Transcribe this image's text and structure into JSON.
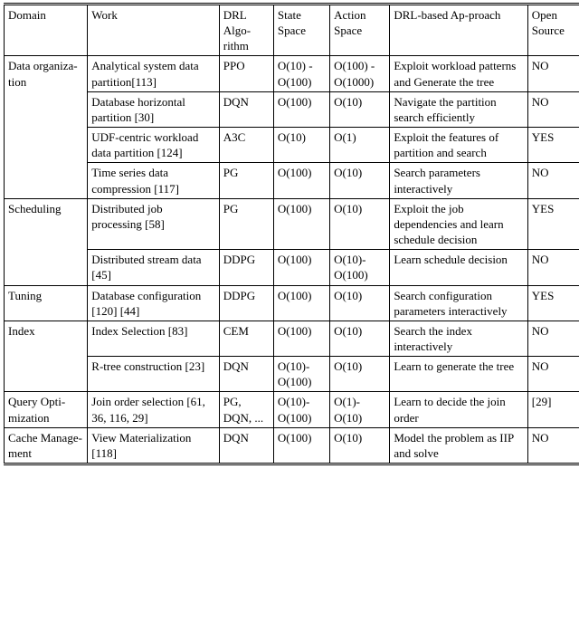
{
  "table": {
    "columns": [
      {
        "key": "domain",
        "label": "Domain"
      },
      {
        "key": "work",
        "label": "Work"
      },
      {
        "key": "algorithm",
        "label": "DRL Algo-rithm"
      },
      {
        "key": "state",
        "label": "State Space"
      },
      {
        "key": "action",
        "label": "Action Space"
      },
      {
        "key": "approach",
        "label": "DRL-based Ap-proach"
      },
      {
        "key": "open",
        "label": "Open Source"
      }
    ],
    "groups": [
      {
        "domain": "Data organiza-tion",
        "rows": [
          {
            "work": "Analytical system data partition[113]",
            "algorithm": "PPO",
            "state": "O(10) - O(100)",
            "action": "O(100) - O(1000)",
            "approach": "Exploit workload patterns and Generate the tree",
            "open": "NO"
          },
          {
            "work": "Database horizontal partition [30]",
            "algorithm": "DQN",
            "state": "O(100)",
            "action": "O(10)",
            "approach": "Navigate the partition search efficiently",
            "open": "NO"
          },
          {
            "work": "UDF-centric workload data partition [124]",
            "algorithm": "A3C",
            "state": "O(10)",
            "action": "O(1)",
            "approach": "Exploit the features of partition and search",
            "open": "YES"
          },
          {
            "work": "Time series data compression [117]",
            "algorithm": "PG",
            "state": "O(100)",
            "action": "O(10)",
            "approach": "Search parameters interactively",
            "open": "NO"
          }
        ]
      },
      {
        "domain": "Scheduling",
        "rows": [
          {
            "work": "Distributed job processing [58]",
            "algorithm": "PG",
            "state": "O(100)",
            "action": "O(10)",
            "approach": "Exploit the job dependencies and learn schedule decision",
            "open": "YES"
          },
          {
            "work": "Distributed stream data [45]",
            "algorithm": "DDPG",
            "state": "O(100)",
            "action": "O(10)-O(100)",
            "approach": "Learn schedule decision",
            "open": "NO"
          }
        ]
      },
      {
        "domain": "Tuning",
        "rows": [
          {
            "work": "Database configuration [120] [44]",
            "algorithm": "DDPG",
            "state": "O(100)",
            "action": "O(10)",
            "approach": "Search configuration parameters interactively",
            "open": "YES"
          }
        ]
      },
      {
        "domain": "Index",
        "rows": [
          {
            "work": "Index Selection [83]",
            "algorithm": "CEM",
            "state": "O(100)",
            "action": "O(10)",
            "approach": "Search the index interactively",
            "open": "NO"
          },
          {
            "work": "R-tree construction [23]",
            "algorithm": "DQN",
            "state": "O(10)-O(100)",
            "action": "O(10)",
            "approach": "Learn to generate the tree",
            "open": "NO"
          }
        ]
      },
      {
        "domain": "Query Opti-mization",
        "rows": [
          {
            "work": "Join order selection [61, 36, 116, 29]",
            "algorithm": "PG, DQN, ...",
            "state": "O(10)-O(100)",
            "action": "O(1)-O(10)",
            "approach": "Learn to decide the join order",
            "open": "[29]"
          }
        ]
      },
      {
        "domain": "Cache Manage-ment",
        "rows": [
          {
            "work": "View Materialization [118]",
            "algorithm": "DQN",
            "state": "O(100)",
            "action": "O(10)",
            "approach": "Model the problem as IIP and solve",
            "open": "NO"
          }
        ]
      }
    ]
  }
}
